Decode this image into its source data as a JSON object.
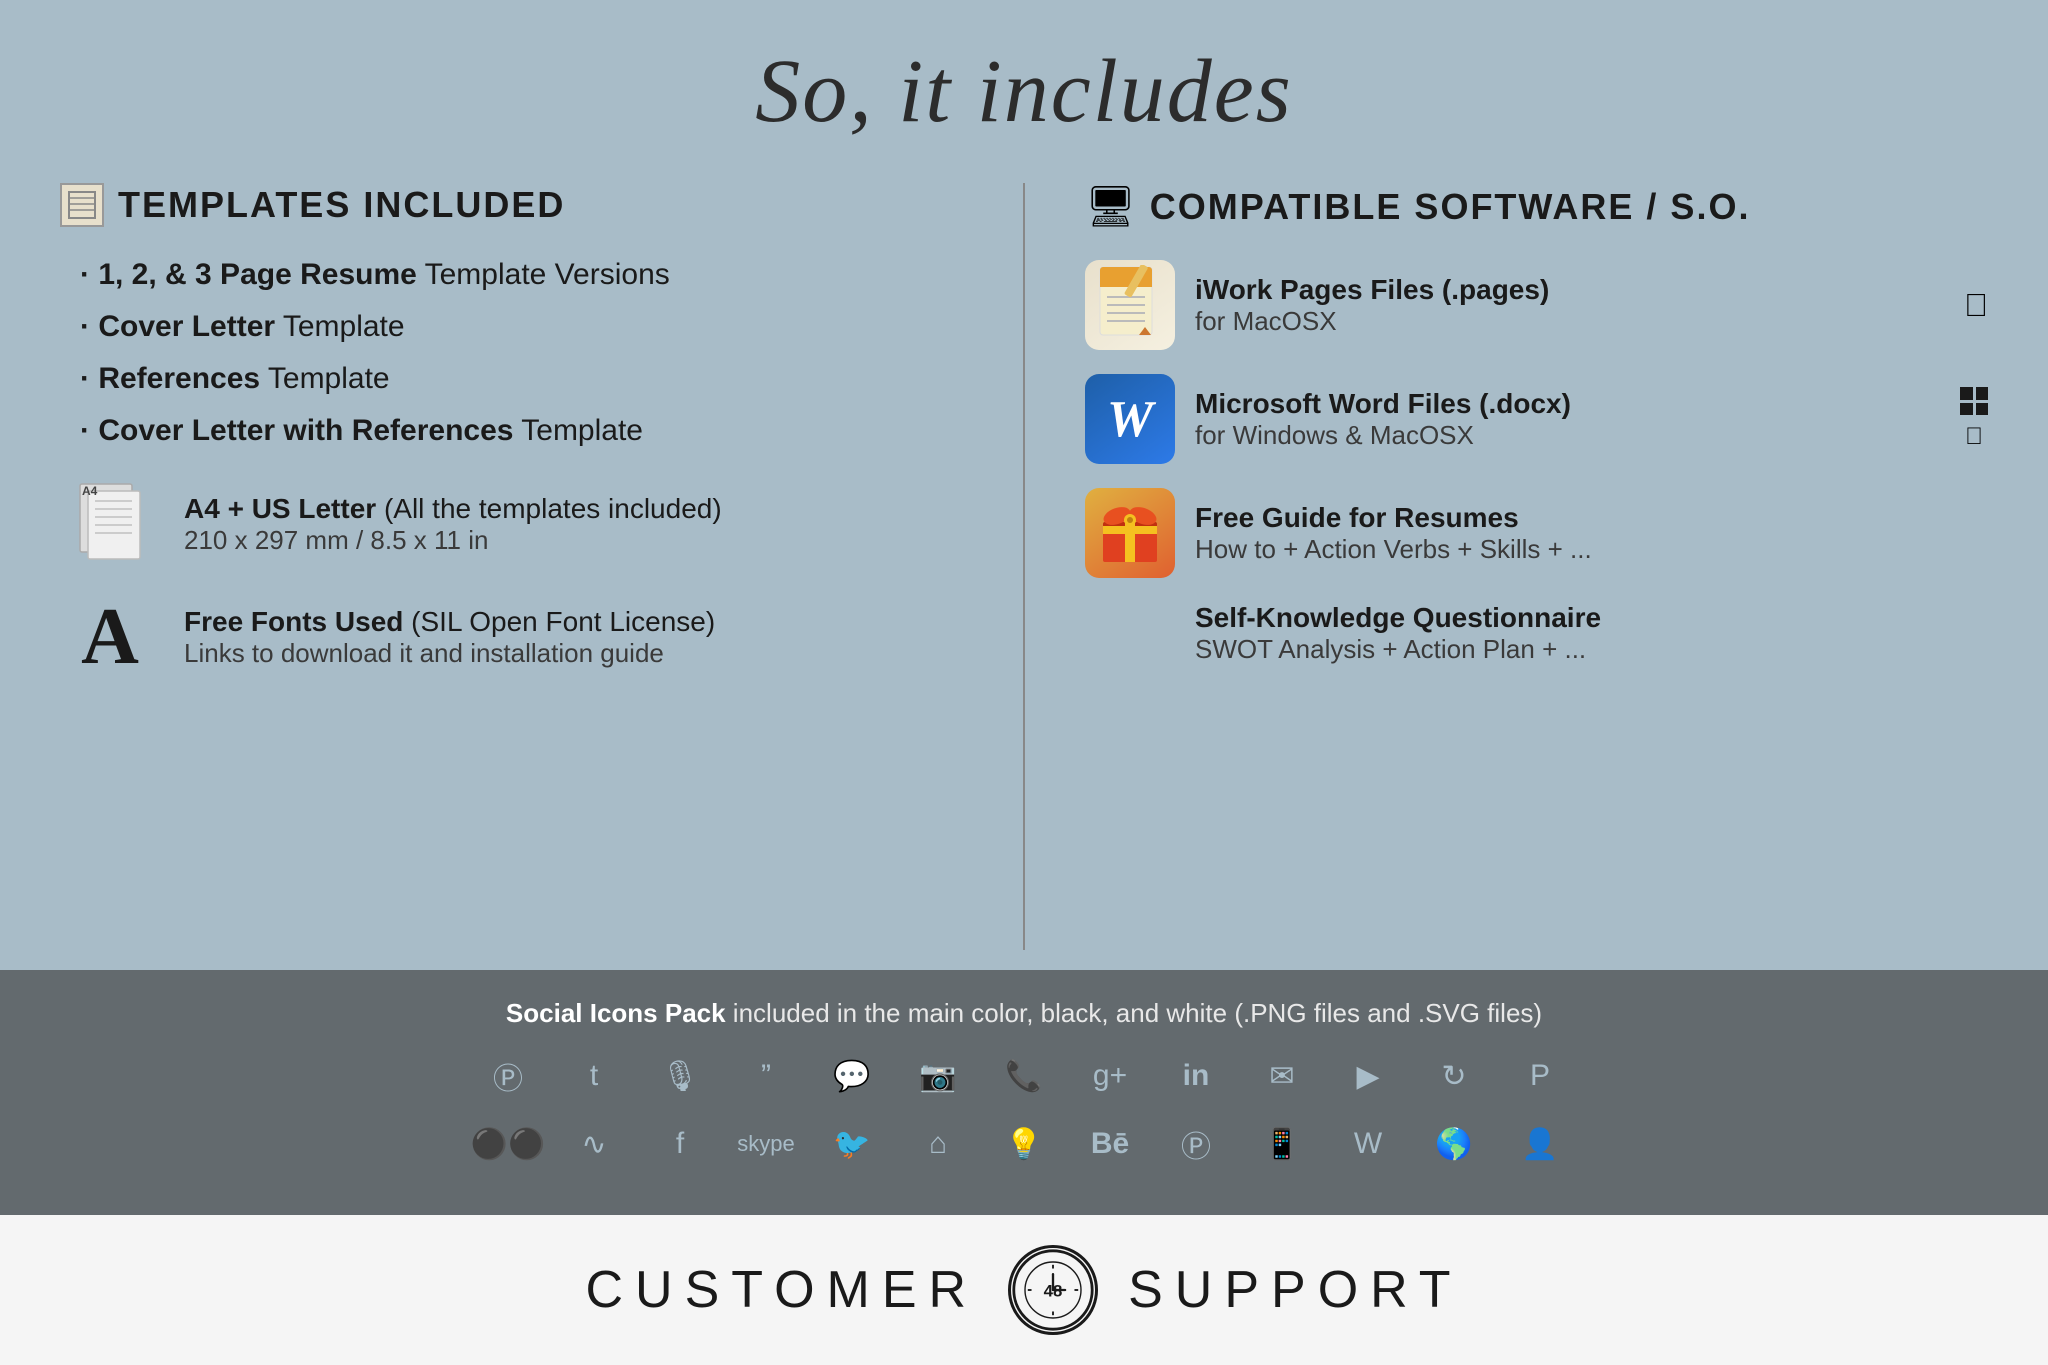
{
  "header": {
    "title": "So, it includes"
  },
  "left": {
    "templates_title": "TEMPLATES INCLUDED",
    "templates": [
      {
        "bold": "1, 2, & 3 Page Resume",
        "rest": " Template Versions"
      },
      {
        "bold": "Cover Letter",
        "rest": " Template"
      },
      {
        "bold": "References",
        "rest": " Template"
      },
      {
        "bold": "Cover Letter with References",
        "rest": " Template"
      }
    ],
    "a4_bold": "A4 + US Letter",
    "a4_rest": " (All the templates included)",
    "a4_size": "210 x 297 mm / 8.5 x 11 in",
    "fonts_bold": "Free Fonts Used",
    "fonts_rest": " (SIL Open Font License)",
    "fonts_sub": "Links to download it and installation guide"
  },
  "right": {
    "compat_title": "COMPATIBLE SOFTWARE / S.O.",
    "items": [
      {
        "name_bold": "iWork Pages Files (.pages)",
        "sub": "for MacOSX",
        "os": [
          "apple"
        ]
      },
      {
        "name_bold": "Microsoft Word Files (.docx)",
        "sub": "for Windows & MacOSX",
        "os": [
          "windows",
          "apple"
        ]
      },
      {
        "name_bold": "Free Guide for Resumes",
        "sub": "How to + Action Verbs + Skills + ..."
      },
      {
        "name_bold": "Self-Knowledge Questionnaire",
        "sub": "SWOT Analysis + Action Plan + ..."
      }
    ]
  },
  "social": {
    "title_bold": "Social Icons Pack",
    "title_rest": " included in the main color, black, and white (.PNG files and .SVG files)",
    "row1": [
      "ⓥ",
      "t",
      "🎙",
      "❝",
      "💬",
      "📷",
      "📞",
      "g+",
      "in",
      "✉",
      "▶",
      "🔄",
      "𝐩"
    ],
    "row2": [
      "••",
      "⟳",
      "f",
      "skype",
      "🐦",
      "⌂",
      "💡",
      "Bē",
      "ⓥ",
      "📱",
      "W",
      "🌐",
      "👤"
    ]
  },
  "footer": {
    "left_text": "CUSTOMER",
    "right_text": "SUPPORT",
    "logo_number": "48"
  }
}
